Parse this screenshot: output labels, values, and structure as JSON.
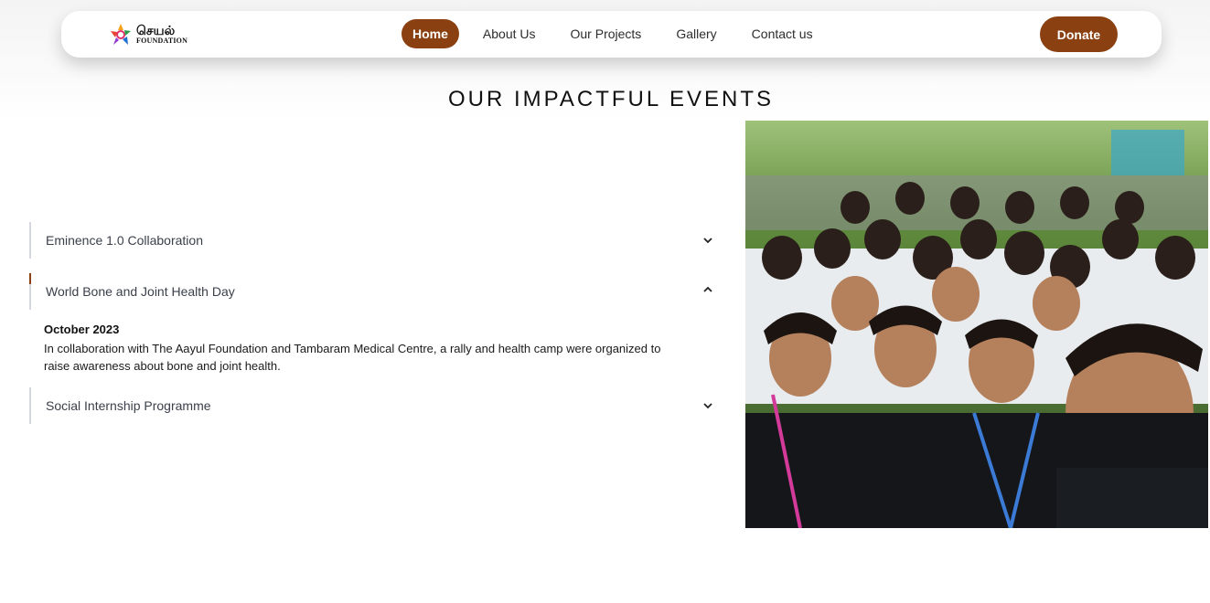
{
  "brand": {
    "tamil_name": "செயல்",
    "subtitle": "FOUNDATION"
  },
  "nav": {
    "items": [
      "Home",
      "About Us",
      "Our Projects",
      "Gallery",
      "Contact us"
    ],
    "active": "Home",
    "donate_label": "Donate"
  },
  "section_title": "OUR IMPACTFUL EVENTS",
  "accordion": [
    {
      "title": "Eminence 1.0 Collaboration",
      "expanded": false
    },
    {
      "title": "World Bone and Joint Health Day",
      "expanded": true,
      "date": "October 2023",
      "description": "In collaboration with The Aayul Foundation and Tambaram Medical Centre, a rally and health camp were organized to raise awareness about bone and joint health."
    },
    {
      "title": "Social Internship Programme",
      "expanded": false
    }
  ],
  "colors": {
    "accent": "#8a4011",
    "border": "#d6d8e0",
    "text": "#3a3f4a"
  },
  "icons": {
    "collapsed": "chevron-down-icon",
    "expanded": "chevron-up-icon"
  }
}
